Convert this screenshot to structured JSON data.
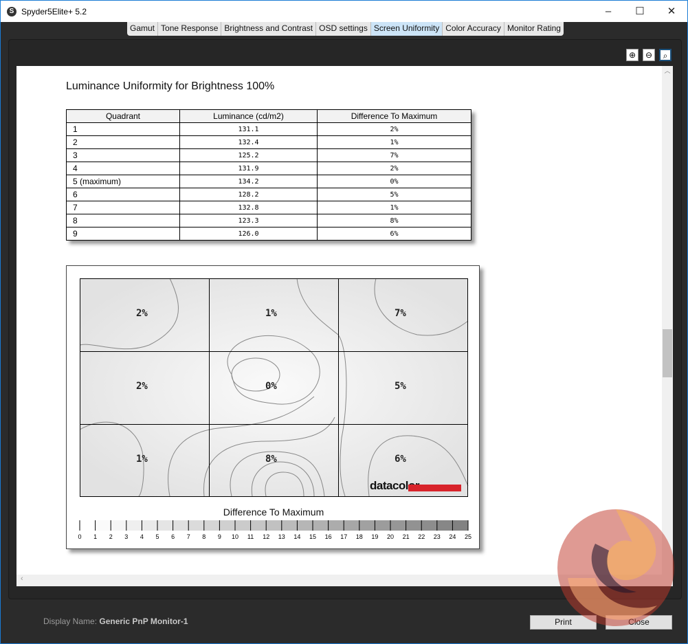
{
  "window": {
    "title": "Spyder5Elite+ 5.2",
    "minimize": "–",
    "maximize": "☐",
    "close": "✕"
  },
  "tabs": [
    {
      "label": "Gamut"
    },
    {
      "label": "Tone Response"
    },
    {
      "label": "Brightness and Contrast"
    },
    {
      "label": "OSD settings"
    },
    {
      "label": "Screen Uniformity",
      "active": true
    },
    {
      "label": "Color Accuracy"
    },
    {
      "label": "Monitor Rating"
    }
  ],
  "zoom": {
    "in": "⊕",
    "out": "⊖",
    "fit": "🔍︎"
  },
  "report": {
    "heading": "Luminance Uniformity for Brightness 100%",
    "columns": [
      "Quadrant",
      "Luminance (cd/m2)",
      "Difference To Maximum"
    ],
    "rows": [
      [
        "1",
        "131.1",
        "2%"
      ],
      [
        "2",
        "132.4",
        "1%"
      ],
      [
        "3",
        "125.2",
        "7%"
      ],
      [
        "4",
        "131.9",
        "2%"
      ],
      [
        "5 (maximum)",
        "134.2",
        "0%"
      ],
      [
        "6",
        "128.2",
        "5%"
      ],
      [
        "7",
        "132.8",
        "1%"
      ],
      [
        "8",
        "123.3",
        "8%"
      ],
      [
        "9",
        "126.0",
        "6%"
      ]
    ],
    "map": {
      "cells": [
        "2%",
        "1%",
        "7%",
        "2%",
        "0%",
        "5%",
        "1%",
        "8%",
        "6%"
      ],
      "logo": "datacolor",
      "legend_title": "Difference To Maximum",
      "legend_ticks": [
        0,
        1,
        2,
        3,
        4,
        5,
        6,
        7,
        8,
        9,
        10,
        11,
        12,
        13,
        14,
        15,
        16,
        17,
        18,
        19,
        20,
        21,
        22,
        23,
        24,
        25
      ]
    }
  },
  "footer": {
    "display_label": "Display Name:",
    "display_name": "Generic PnP Monitor-1",
    "print": "Print",
    "close": "Close"
  },
  "colors": {
    "accent": "#cce4f7",
    "logo_red": "#d8232a"
  }
}
